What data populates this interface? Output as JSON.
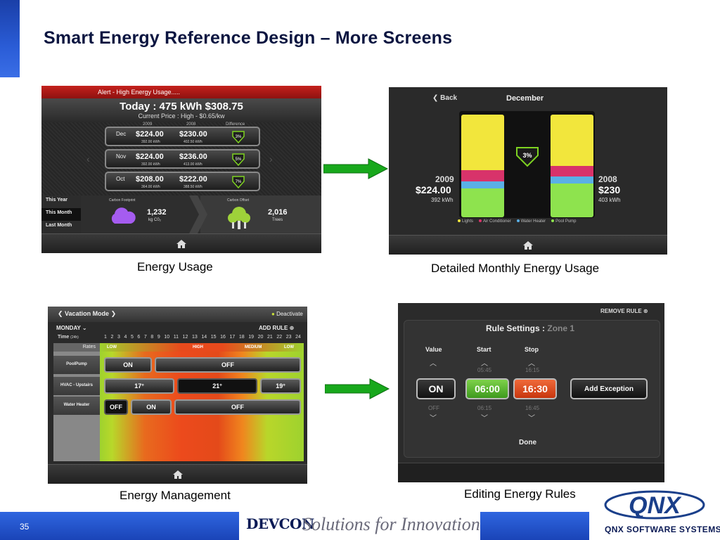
{
  "slide": {
    "title": "Smart Energy Reference Design – More Screens",
    "page_number": "35",
    "footer_brand": "DEVCON",
    "footer_tagline": "Solutions for Innovation",
    "company": "QNX SOFTWARE SYSTEMS",
    "logo_text": "QNX"
  },
  "captions": {
    "energy_usage": "Energy Usage",
    "detailed": "Detailed Monthly Energy Usage",
    "management": "Energy Management",
    "editing": "Editing Energy Rules"
  },
  "energy_usage": {
    "alert": "Alert - High Energy Usage.....",
    "today": "Today : 475 kWh    $308.75",
    "price": "Current Price : High - $0.65/kw",
    "col_2009": "2009",
    "col_2008": "2008",
    "col_diff": "Difference",
    "rows": [
      {
        "month": "Dec",
        "v2009": "$224.00",
        "k2009": "392.00 kWh",
        "v2008": "$230.00",
        "k2008": "402.50 kWh",
        "diff": "3%"
      },
      {
        "month": "Nov",
        "v2009": "$224.00",
        "k2009": "392.00 kWh",
        "v2008": "$236.00",
        "k2008": "413.00 kWh",
        "diff": "5%"
      },
      {
        "month": "Oct",
        "v2009": "$208.00",
        "k2009": "364.00 kWh",
        "v2008": "$222.00",
        "k2008": "388.50 kWh",
        "diff": "7%"
      }
    ],
    "menu": [
      "This Year",
      "This Month",
      "Last Month"
    ],
    "footprint_label": "Carbon Footprint",
    "footprint_value": "1,232",
    "footprint_unit": "kg C0₂",
    "offset_label": "Carbon Offset",
    "offset_value": "2,016",
    "offset_unit": "Trees"
  },
  "detailed": {
    "back": "Back",
    "month": "December",
    "diff": "3%",
    "left_year": "2009",
    "left_amount": "$224.00",
    "left_kwh": "392 kWh",
    "right_year": "2008",
    "right_amount": "$230",
    "right_kwh": "403 kWh",
    "legend": [
      "Lights",
      "Air Conditioner",
      "Water Heater",
      "Pool Pump"
    ],
    "colors": {
      "lights": "#f2e63c",
      "ac": "#d8336a",
      "water": "#5ab0e6",
      "pool": "#8ee34e"
    }
  },
  "management": {
    "mode": "Vacation Mode",
    "deactivate": "Deactivate",
    "day": "MONDAY",
    "add_rule": "ADD RULE",
    "time_label": "Time",
    "time_sub": "(24h)",
    "hours": [
      "1",
      "2",
      "3",
      "4",
      "5",
      "6",
      "7",
      "8",
      "9",
      "10",
      "11",
      "12",
      "13",
      "14",
      "15",
      "16",
      "17",
      "18",
      "19",
      "20",
      "21",
      "22",
      "23",
      "24"
    ],
    "rates_label": "Rates",
    "rates": {
      "low1": "LOW",
      "high": "HIGH",
      "medium": "MEDIUM",
      "low2": "LOW"
    },
    "devices": [
      "PoolPump",
      "HVAC - Upstairs",
      "Water Heater"
    ],
    "pool": [
      "ON",
      "OFF"
    ],
    "hvac": [
      "17°",
      "21°",
      "19°"
    ],
    "water": [
      "OFF",
      "ON",
      "OFF"
    ]
  },
  "editing": {
    "remove_rule": "REMOVE RULE",
    "title": "Rule Settings :",
    "zone": "Zone 1",
    "value_label": "Value",
    "start_label": "Start",
    "stop_label": "Stop",
    "start_prev": "05:45",
    "stop_prev": "16:15",
    "value": "ON",
    "start": "06:00",
    "stop": "16:30",
    "add_exception": "Add Exception",
    "value_next": "OFF",
    "start_next": "06:15",
    "stop_next": "16:45",
    "done": "Done"
  }
}
